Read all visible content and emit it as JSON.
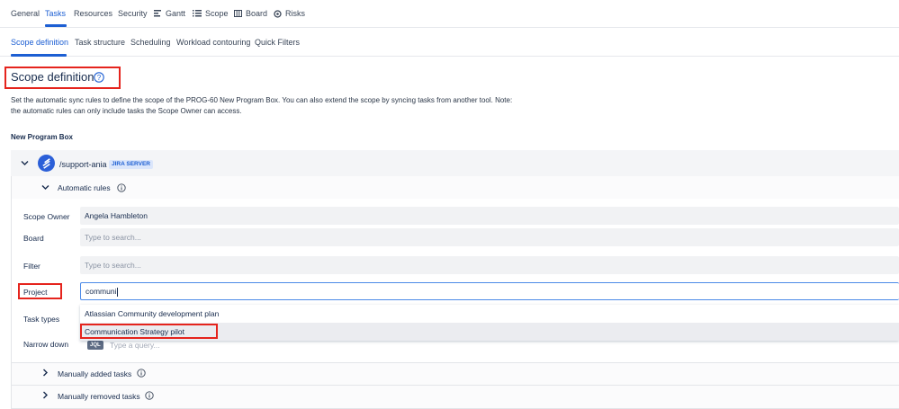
{
  "top_tabs": [
    {
      "label": "General",
      "icon": null
    },
    {
      "label": "Tasks",
      "icon": null,
      "active": true
    },
    {
      "label": "Resources",
      "icon": null
    },
    {
      "label": "Security",
      "icon": null
    },
    {
      "label": "Gantt",
      "icon": "gantt-icon"
    },
    {
      "label": "Scope",
      "icon": "list-icon"
    },
    {
      "label": "Board",
      "icon": "board-icon"
    },
    {
      "label": "Risks",
      "icon": "risk-icon"
    }
  ],
  "sub_tabs": [
    {
      "label": "Scope definition",
      "active": true
    },
    {
      "label": "Task structure"
    },
    {
      "label": "Scheduling"
    },
    {
      "label": "Workload contouring"
    },
    {
      "label": "Quick Filters"
    }
  ],
  "page": {
    "title": "Scope definition",
    "description": "Set the automatic sync rules to define the scope of the PROG-60 New Program Box. You can also extend the scope by syncing tasks from another tool. Note: the automatic rules can only include tasks the Scope Owner can access.",
    "section_label": "New Program Box"
  },
  "connection": {
    "name": "/support-ania",
    "badge": "JIRA SERVER"
  },
  "automatic_rules": {
    "label": "Automatic rules",
    "fields": {
      "scope_owner_label": "Scope Owner",
      "scope_owner_value": "Angela Hambleton",
      "board_label": "Board",
      "board_placeholder": "Type to search...",
      "filter_label": "Filter",
      "filter_placeholder": "Type to search...",
      "project_label": "Project",
      "project_value": "communi",
      "task_types_label": "Task types",
      "narrow_down_label": "Narrow down",
      "jql_tag": "JQL",
      "jql_placeholder": "Type a query..."
    },
    "project_options": [
      "Atlassian Community development plan",
      "Communication Strategy pilot"
    ]
  },
  "manually_added": {
    "label": "Manually added tasks"
  },
  "manually_removed": {
    "label": "Manually removed tasks"
  },
  "colors": {
    "accent": "#1d5fd3",
    "highlight": "#e5241d"
  }
}
